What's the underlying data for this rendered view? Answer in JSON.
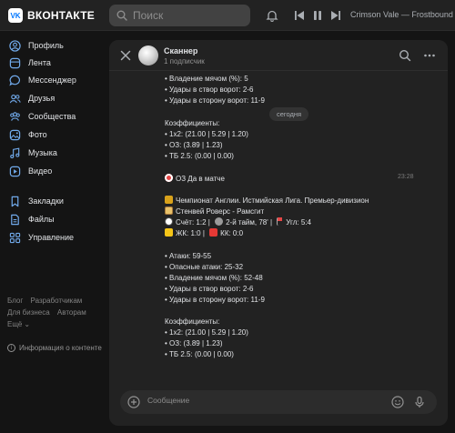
{
  "topbar": {
    "logo_badge": "VK",
    "logo_text": "ВКОНТАКТЕ",
    "search_placeholder": "Поиск",
    "now_playing": "Crimson Vale — Frostbound V"
  },
  "sidebar": {
    "items": [
      {
        "label": "Профиль",
        "icon": "profile-icon"
      },
      {
        "label": "Лента",
        "icon": "feed-icon"
      },
      {
        "label": "Мессенджер",
        "icon": "messenger-icon"
      },
      {
        "label": "Друзья",
        "icon": "friends-icon"
      },
      {
        "label": "Сообщества",
        "icon": "communities-icon"
      },
      {
        "label": "Фото",
        "icon": "photo-icon"
      },
      {
        "label": "Музыка",
        "icon": "music-icon"
      },
      {
        "label": "Видео",
        "icon": "video-icon"
      },
      {
        "label": "Закладки",
        "icon": "bookmark-icon"
      },
      {
        "label": "Файлы",
        "icon": "files-icon"
      },
      {
        "label": "Управление",
        "icon": "manage-icon"
      }
    ],
    "footer_links": [
      "Блог",
      "Разработчикам",
      "Для бизнеса",
      "Авторам",
      "Ещё"
    ],
    "info_label": "Информация о контенте"
  },
  "chat": {
    "name": "Сканнер",
    "subscribers": "1 подписчик",
    "date_label": "сегодня",
    "composer_placeholder": "Сообщение",
    "msg1": {
      "possession": "• Владение мячом (%):  5",
      "shots_on": "• Удары в створ ворот:  2-6",
      "shots_off": "• Удары в сторону ворот:  11-9",
      "coef_title": "Коэффициенты:",
      "coef_1x2": "• 1x2: (21.00 | 5.29 | 1.20)",
      "coef_oz": "• ОЗ: (3.89 | 1.23)",
      "coef_tb": "• ТБ 2.5: (0.00 | 0.00)"
    },
    "msg2": {
      "time": "23:28",
      "headline": "ОЗ Да в матче",
      "league": "Чемпионат Англии. Истмийская Лига. Премьер-дивизион",
      "teams": "Стенвей Роверс - Рамсгит",
      "score": "Счёт: 1:2 |",
      "period": "2-й тайм, 78' |",
      "corners": "Угл: 5:4",
      "yellow": "ЖК: 1:0 |",
      "red": "КК: 0:0",
      "attacks": "• Атаки:  59-55",
      "dangerous": "• Опасные атаки: 25-32",
      "possession": "• Владение мячом (%):  52-48",
      "shots_on": "• Удары в створ ворот:  2-6",
      "shots_off": "• Удары в сторону ворот:  11-9",
      "coef_title": "Коэффициенты:",
      "coef_1x2": "• 1x2: (21.00 | 5.29 | 1.20)",
      "coef_oz": "• ОЗ: (3.89 | 1.23)",
      "coef_tb": "• ТБ 2.5: (0.00 | 0.00)"
    }
  },
  "colors": {
    "background": "#141414",
    "panel": "#222222",
    "accent": "#0077ff",
    "text": "#e1e3e6",
    "muted": "#939393"
  }
}
